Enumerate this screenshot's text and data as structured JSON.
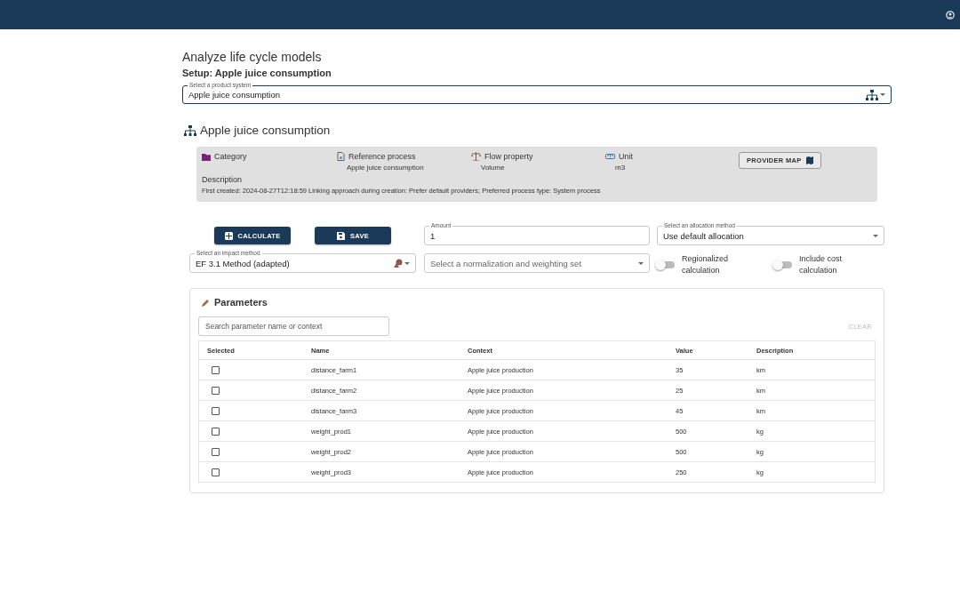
{
  "page_title": "Analyze life cycle models",
  "setup_title": "Setup: Apple juice consumption",
  "product_system": {
    "label": "Select a product system",
    "value": "Apple juice consumption"
  },
  "system_heading": "Apple juice consumption",
  "info": {
    "category_label": "Category",
    "reference_process_label": "Reference process",
    "reference_process": "Apple juice consumption",
    "flow_property_label": "Flow property",
    "flow_property": "Volume",
    "unit_label": "Unit",
    "unit": "m3",
    "provider_map_button": "PROVIDER MAP",
    "description_label": "Description",
    "description": "First created: 2024-08-27T12:18:59 Linking approach during creation: Prefer default providers; Preferred process type: System process"
  },
  "actions": [
    {
      "kind": "calculate",
      "label": "CALCULATE"
    },
    {
      "kind": "save",
      "label": "SAVE"
    }
  ],
  "amount": {
    "label": "Amount",
    "value": "1"
  },
  "allocation": {
    "label": "Select an allocation method",
    "value": "Use default allocation"
  },
  "impact_method": {
    "label": "Select an impact method",
    "value": "EF 3.1 Method (adapted)"
  },
  "normalization": {
    "placeholder": "Select a normalization and weighting set"
  },
  "toggles": [
    {
      "label": "Regionalized calculation",
      "on": false
    },
    {
      "label": "Include cost calculation",
      "on": false
    }
  ],
  "parameters": {
    "title": "Parameters",
    "search": {
      "placeholder": "Search parameter name or context"
    },
    "clear_button": {
      "label": "CLEAR",
      "disabled": true
    },
    "columns": [
      "Selected",
      "Name",
      "Context",
      "Value",
      "Description"
    ],
    "rows": [
      {
        "checked": false,
        "name": "distance_farm1",
        "context": "Apple juice production",
        "value": "35",
        "description": "km"
      },
      {
        "checked": false,
        "name": "distance_farm2",
        "context": "Apple juice production",
        "value": "25",
        "description": "km"
      },
      {
        "checked": false,
        "name": "distance_farm3",
        "context": "Apple juice production",
        "value": "45",
        "description": "km"
      },
      {
        "checked": false,
        "name": "weight_prod1",
        "context": "Apple juice production",
        "value": "500",
        "description": "kg"
      },
      {
        "checked": false,
        "name": "weight_prod2",
        "context": "Apple juice production",
        "value": "500",
        "description": "kg"
      },
      {
        "checked": false,
        "name": "weight_prod3",
        "context": "Apple juice production",
        "value": "250",
        "description": "kg"
      }
    ]
  }
}
